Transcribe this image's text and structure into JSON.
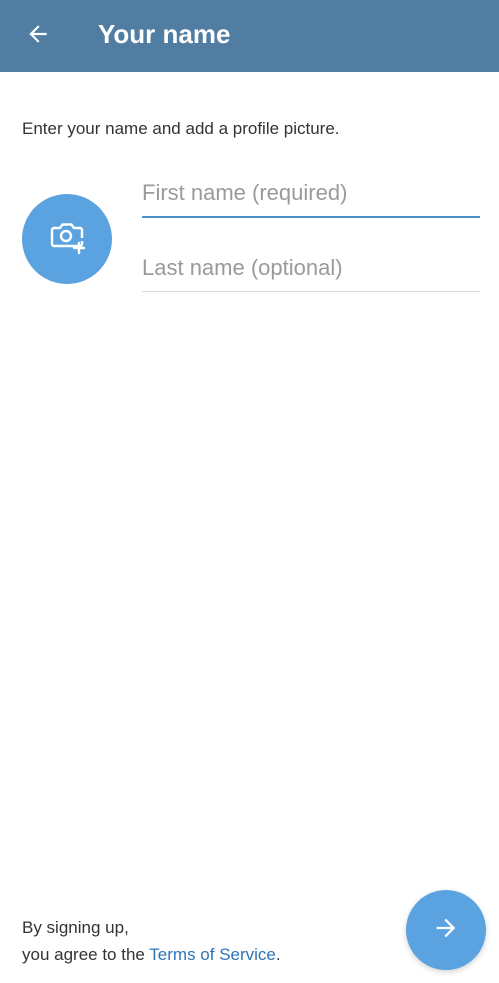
{
  "header": {
    "title": "Your name",
    "back_icon": "arrow-left-icon",
    "background_color": "#517da2"
  },
  "form": {
    "instruction": "Enter your name and add a profile picture.",
    "avatar_icon": "camera-add-icon",
    "first_name": {
      "value": "",
      "placeholder": "First name (required)"
    },
    "last_name": {
      "value": "",
      "placeholder": "Last name (optional)"
    }
  },
  "footer": {
    "terms_line1": "By signing up,",
    "terms_prefix": "you agree to the ",
    "terms_link": "Terms of Service",
    "terms_suffix": ".",
    "next_icon": "arrow-right-icon",
    "accent_color": "#5aa3e0"
  }
}
